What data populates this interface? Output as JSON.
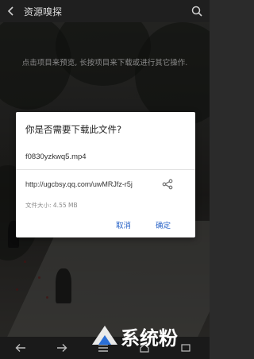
{
  "topbar": {
    "title": "资源嗅探",
    "back_icon": "arrow-left-icon",
    "search_icon": "search-icon"
  },
  "background": {
    "hint": "点击项目来预览, 长按项目来下载或进行其它操作."
  },
  "dialog": {
    "title": "你是否需要下载此文件?",
    "filename": "f0830yzkwq5.mp4",
    "url": "http://ugcbsy.qq.com/uwMRJfz-r5j",
    "size": "文件大小: 4.55 MB",
    "cancel_label": "取消",
    "ok_label": "确定",
    "accent": "#2a64c8"
  },
  "annotation": {
    "arrow_color": "#e0181b"
  },
  "watermark": {
    "text": "系统粉"
  },
  "bottombar": {
    "items": [
      "arrow-left-icon",
      "arrow-right-icon",
      "menu-icon",
      "home-icon",
      "tabs-icon"
    ]
  }
}
